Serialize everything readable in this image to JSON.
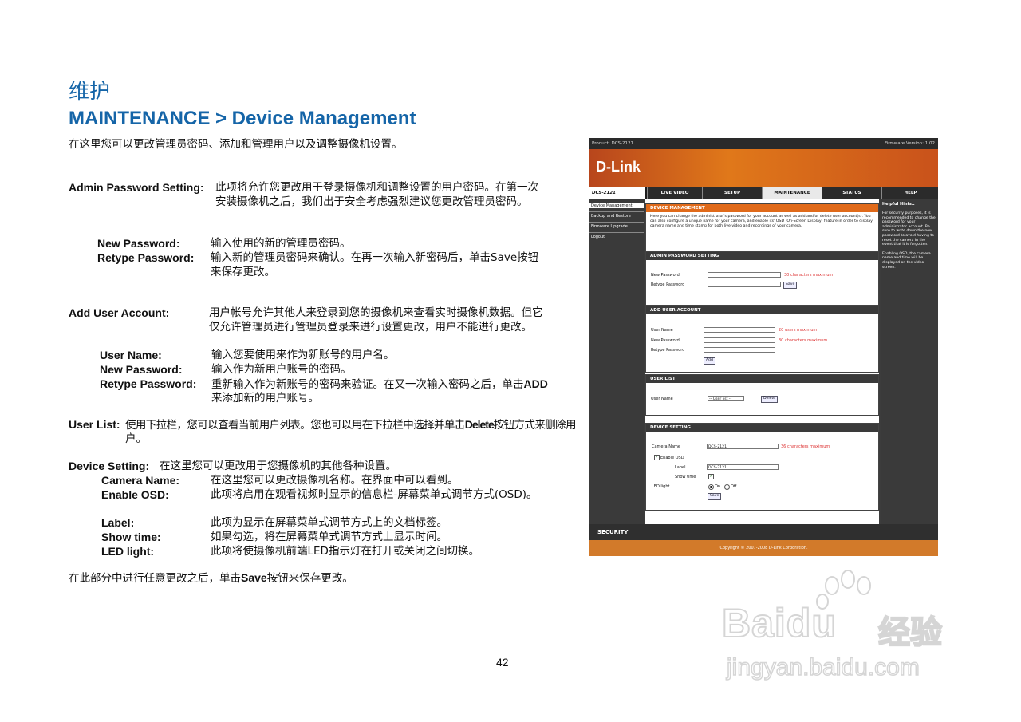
{
  "heading_cn": "维护",
  "heading_en": "MAINTENANCE > Device Management",
  "intro": "在这里您可以更改管理员密码、添加和管理用户以及调整摄像机设置。",
  "admin": {
    "label": "Admin Password Setting:",
    "desc1": "此项将允许您更改用于登录摄像机和调整设置的用户密码。在第一次",
    "desc2": "安装摄像机之后，我们出于安全考虑强烈建议您更改管理员密码。",
    "new_pw_label": "New Password:",
    "new_pw_desc": "输入使用的新的管理员密码。",
    "retype_label": "Retype Password:",
    "retype_desc1": "输入新的管理员密码来确认。在再一次输入新密码后，单击Save按钮",
    "retype_desc2": "来保存更改。"
  },
  "add_user": {
    "label": "Add User Account:",
    "desc1": "用户帐号允许其他人来登录到您的摄像机来查看实时摄像机数据。但它",
    "desc2": "仅允许管理员进行管理员登录来进行设置更改，用户不能进行更改。",
    "user_name_label": "User Name:",
    "user_name_desc": "输入您要使用来作为新账号的用户名。",
    "new_pw_label": "New Password:",
    "new_pw_desc": "输入作为新用户账号的密码。",
    "retype_label": "Retype Password:",
    "retype_desc1": "重新输入作为新账号的密码来验证。在又一次输入密码之后，单击",
    "retype_add": "ADD",
    "retype_desc2": "来添加新的用户账号。"
  },
  "user_list": {
    "label": "User List:",
    "desc1a": "使用下拉栏，您可以查看当前用户列表。您也可以用在下拉栏中选择并单击",
    "desc1_delete": "Delete",
    "desc1b": "按钮方式来删除用",
    "desc2": "户。"
  },
  "device_setting": {
    "label": "Device Setting:",
    "desc": "在这里您可以更改用于您摄像机的其他各种设置。",
    "camera_label": "Camera Name:",
    "camera_desc": "在这里您可以更改摄像机名称。在界面中可以看到。",
    "osd_label": "Enable OSD:",
    "osd_desc": "此项将启用在观看视频时显示的信息栏-屏幕菜单式调节方式(OSD)。",
    "label_label": "Label:",
    "label_desc": "此项为显示在屏幕菜单式调节方式上的文档标签。",
    "showtime_label": "Show time:",
    "showtime_desc": "如果勾选，将在屏幕菜单式调节方式上显示时间。",
    "led_label": "LED light:",
    "led_desc": "此项将使摄像机前端LED指示灯在打开或关闭之间切换。"
  },
  "footer_a": "在此部分中进行任意更改之后，单击",
  "footer_save": "Save",
  "footer_b": "按钮来保存更改。",
  "page_number": "42",
  "screenshot": {
    "product": "Product: DCS-2121",
    "firmware": "Firmware Version: 1.02",
    "logo": "D-Link",
    "model": "DCS-2121",
    "tabs": [
      "LIVE VIDEO",
      "SETUP",
      "MAINTENANCE",
      "STATUS",
      "HELP"
    ],
    "left_nav": [
      "Device Management",
      "Backup and Restore",
      "Firmware Upgrade",
      "Logout"
    ],
    "dm_title": "DEVICE MANAGEMENT",
    "dm_text": "Here you can change the administrator's password for your account as well as add and/or delete user account(s). You can also configure a unique name for your camera, and enable its' OSD (On-Screen Display) feature in order to display camera name and time stamp for both live video and recordings of your camera.",
    "admin_title": "ADMIN PASSWORD SETTING",
    "new_password": "New Password",
    "retype_password": "Retype Password",
    "max30": "30 characters maximum",
    "save": "Save",
    "add_title": "ADD USER ACCOUNT",
    "user_name": "User Name",
    "max20": "20 users maximum",
    "add": "Add",
    "list_title": "USER LIST",
    "user_list_select": "-- User list --",
    "delete": "Delete",
    "device_title": "DEVICE SETTING",
    "camera_name": "Camera Name",
    "camera_value": "DCS-2121",
    "max36": "36 characters maximum",
    "enable_osd": "Enable OSD",
    "label": "Label",
    "label_value": "DCS-2121",
    "show_time": "Show time",
    "led_light": "LED light",
    "on": "On",
    "off": "Off",
    "help_title": "Helpful Hints..",
    "help_text1": "For security purposes, it is recommended to change the password for your administrator account. Be sure to write down the new password to avoid having to reset the camera in the event that it is forgotten.",
    "help_text2": "Enabling OSD, the camera name and time will be displayed on the video screen.",
    "security": "SECURITY",
    "copyright": "Copyright © 2007-2008 D-Link Corporation."
  },
  "watermark": {
    "brand": "Baidu",
    "cn": "经验",
    "url": "jingyan.baidu.com"
  }
}
